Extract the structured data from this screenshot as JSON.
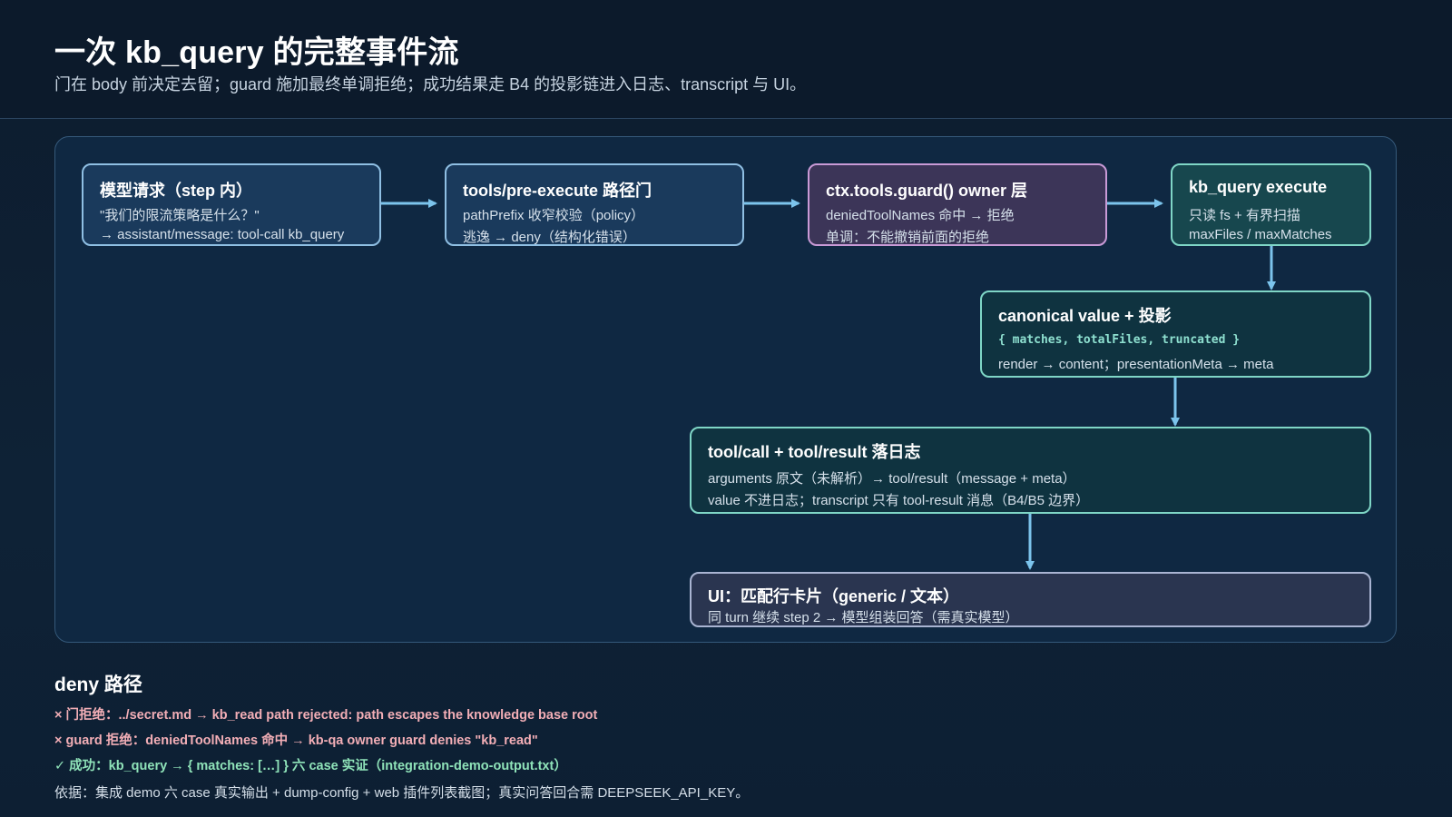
{
  "header": {
    "title": "一次 kb_query 的完整事件流",
    "subtitle": "门在 body 前决定去留；guard 施加最终单调拒绝；成功结果走 B4 的投影链进入日志、transcript 与 UI。"
  },
  "nodes": {
    "model_request": {
      "title": "模型请求（step 内）",
      "line1": "\"我们的限流策略是什么？\"",
      "line2": "→ assistant/message: tool-call kb_query"
    },
    "pre_execute": {
      "title": "tools/pre-execute 路径门",
      "line1": "pathPrefix 收窄校验（policy）",
      "line2": "逃逸 → deny（结构化错误）"
    },
    "guard": {
      "title": "ctx.tools.guard() owner 层",
      "line1": "deniedToolNames 命中 → 拒绝",
      "line2": "单调：不能撤销前面的拒绝"
    },
    "execute": {
      "title": "kb_query execute",
      "line1": "只读 fs + 有界扫描",
      "line2": "maxFiles / maxMatches"
    },
    "canonical": {
      "title": "canonical value + 投影",
      "code": "{ matches, totalFiles, truncated }",
      "line2": "render → content；presentationMeta → meta"
    },
    "log": {
      "title": "tool/call + tool/result 落日志",
      "line1": "arguments 原文（未解析）→ tool/result（message + meta）",
      "line2": "value 不进日志；transcript 只有 tool-result 消息（B4/B5 边界）"
    },
    "ui": {
      "title": "UI：匹配行卡片（generic / 文本）",
      "line1": "同 turn 继续 step 2 → 模型组装回答（需真实模型）"
    }
  },
  "deny": {
    "title": "deny 路径",
    "line1": "× 门拒绝：../secret.md → kb_read path rejected: path escapes the knowledge base root",
    "line2": "× guard 拒绝：deniedToolNames 命中 → kb-qa owner guard denies \"kb_read\"",
    "line3": "✓ 成功：kb_query → { matches: […] } 六 case 实证（integration-demo-output.txt）",
    "evidence": "依据：集成 demo 六 case 真实输出 + dump-config + web 插件列表截图；真实问答回合需 DEEPSEEK_API_KEY。"
  },
  "colors": {
    "arrow": "#7cc4ec",
    "accent_blue": "#8fbfe3",
    "accent_purple": "#c99ad6",
    "accent_teal": "#7fd6c6",
    "deny_red": "#f2aeb6",
    "success_green": "#8fe3b9"
  }
}
